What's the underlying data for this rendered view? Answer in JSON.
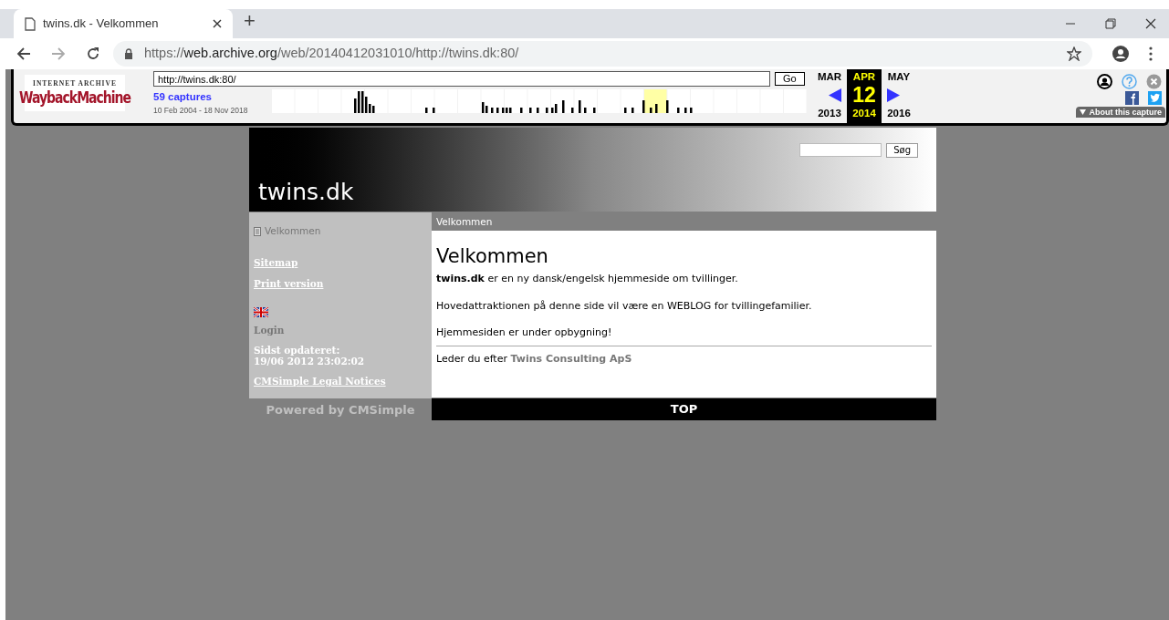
{
  "browser": {
    "tab": {
      "title": "twins.dk - Velkommen",
      "selected": true
    },
    "new_tab": "+",
    "url": {
      "scheme": "https://",
      "domain": "web.archive.org",
      "path": "/web/20140412031010/http://twins.dk:80/"
    }
  },
  "wayback": {
    "logo_top": "INTERNET ARCHIVE",
    "logo_main": "WaybackMachine",
    "url_value": "http://twins.dk:80/",
    "go": "Go",
    "captures": "59 captures",
    "range": "10 Feb 2004 - 18 Nov 2018",
    "months": [
      {
        "label": "MAR",
        "year": "2013",
        "selected": false
      },
      {
        "label": "APR",
        "day": "12",
        "year": "2014",
        "selected": true
      },
      {
        "label": "MAY",
        "year": "2016",
        "selected": false
      }
    ],
    "about": "About this capture"
  },
  "site": {
    "title": "twins.dk",
    "search_button": "Søg",
    "sidebar": {
      "current": "Velkommen",
      "links": [
        "Sitemap",
        "Print version"
      ],
      "login": "Login",
      "updated_label": "Sidst opdateret:",
      "updated_value": "19/06 2012 23:02:02",
      "legal": "CMSimple Legal Notices"
    },
    "breadcrumb": "Velkommen",
    "heading": "Velkommen",
    "paragraphs": [
      "**twins.dk** er en ny dansk/engelsk hjemmeside om tvillinger.",
      "Hovedattraktionen på denne side vil være en WEBLOG for tvillingefamilier.",
      "Hjemmesiden er under opbygning!"
    ],
    "footer_note": {
      "text": "Leder du efter",
      "link": "Twins Consulting ApS"
    },
    "powered": "Powered by CMSimple",
    "top": "TOP"
  }
}
